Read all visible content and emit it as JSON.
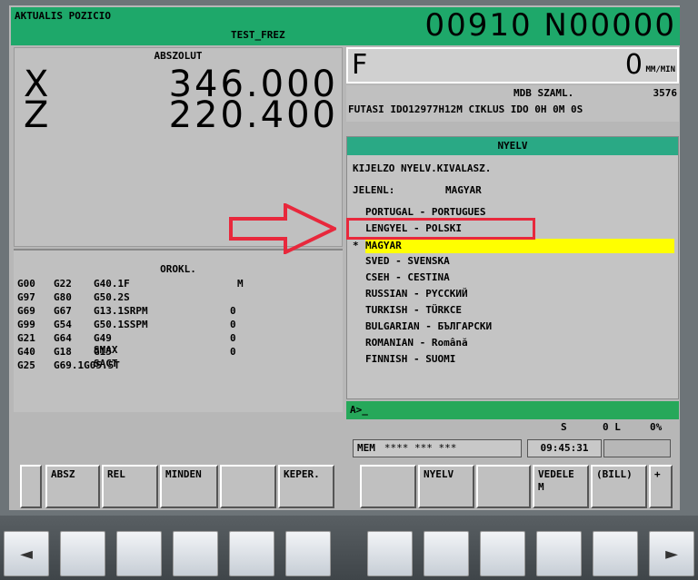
{
  "header": {
    "position_title": "AKTUALIS POZICIO",
    "program_name": "TEST_FREZ",
    "program_number": "00910 N00000"
  },
  "position": {
    "mode_label": "ABSZOLUT",
    "x_label": "X",
    "x_value": "346.000",
    "z_label": "Z",
    "z_value": "220.400"
  },
  "modal": {
    "title": "OROKL.",
    "rows": [
      [
        "G00",
        "G22",
        "G40.1F",
        "",
        "M"
      ],
      [
        "G97",
        "G80",
        "G50.2S",
        "",
        ""
      ],
      [
        "G69",
        "G67",
        "G13.1SRPM",
        "0",
        ""
      ],
      [
        "G99",
        "G54",
        "G50.1SSPM",
        "0",
        ""
      ],
      [
        "G21",
        "G64",
        "G49  SMAX",
        "0",
        ""
      ],
      [
        "G40",
        "G18",
        "G15  SACT",
        "0",
        ""
      ],
      [
        "G25",
        "G69.1G05.5T",
        "",
        "",
        ""
      ]
    ]
  },
  "feed": {
    "letter": "F",
    "value": "0",
    "unit": "MM/MIN"
  },
  "mdb": {
    "label": "MDB SZAML.",
    "value": "3576",
    "runtime": "FUTASI IDO12977H12M CIKLUS  IDO 0H 0M 0S"
  },
  "language_panel": {
    "title": "NYELV",
    "prompt": "KIJELZO NYELV.KIVALASZ.",
    "current_label": "JELENL:",
    "current_value": "MAGYAR",
    "languages": [
      "PORTUGAL - PORTUGUES",
      "LENGYEL - POLSKI",
      "MAGYAR",
      "SVED - SVENSKA",
      "CSEH - CESTINA",
      "RUSSIAN - PYCCKИЙ",
      "TURKISH - TÜRKCE",
      "BULGARIAN - БЪЛГАРСКИ",
      "ROMANIAN - Română",
      "FINNISH - SUOMI"
    ],
    "selected_marker": "*",
    "highlight_color": "#ffff00",
    "annotation_color": "#e8283c"
  },
  "status": {
    "input_prompt": "A>_",
    "spindle": "S",
    "load": "0 L",
    "percent": "0%",
    "mode": "MEM",
    "state": "**** *** ***",
    "clock": "09:45:31"
  },
  "softkeys": {
    "left": [
      "ABSZ",
      "REL",
      "MINDEN",
      "",
      "KEPER."
    ],
    "right": [
      "",
      "NYELV",
      "",
      "VEDELE M",
      "(BILL)",
      "+"
    ]
  },
  "hardware_keys": {
    "prev": "◄",
    "next": "►"
  }
}
